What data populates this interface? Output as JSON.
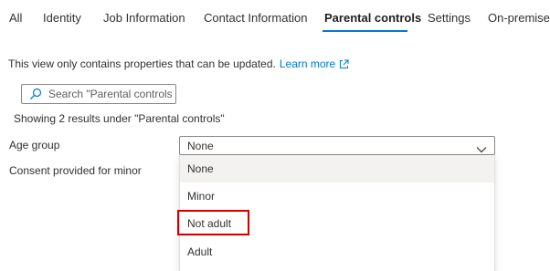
{
  "tabs": [
    {
      "label": "All"
    },
    {
      "label": "Identity"
    },
    {
      "label": "Job Information"
    },
    {
      "label": "Contact Information"
    },
    {
      "label": "Parental controls",
      "active": true
    },
    {
      "label": "Settings"
    },
    {
      "label": "On-premises"
    }
  ],
  "info": {
    "text": "This view only contains properties that can be updated.",
    "learn_more": "Learn more"
  },
  "search": {
    "placeholder": "Search \"Parental controls\" ..."
  },
  "results_text": "Showing 2 results under \"Parental controls\"",
  "fields": {
    "age_group_label": "Age group",
    "consent_label": "Consent provided for minor"
  },
  "age_group_select": {
    "value": "None",
    "options": [
      {
        "label": "None",
        "selected": true
      },
      {
        "label": "Minor"
      },
      {
        "label": "Not adult",
        "highlighted": true
      },
      {
        "label": "Adult"
      }
    ]
  },
  "colors": {
    "accent": "#0078d4",
    "highlight_border": "#d10000",
    "selected_option_bg": "#f3f2f1"
  },
  "icons": {
    "learn_more": "external-link-icon",
    "search": "search-icon",
    "select": "chevron-down-icon"
  }
}
